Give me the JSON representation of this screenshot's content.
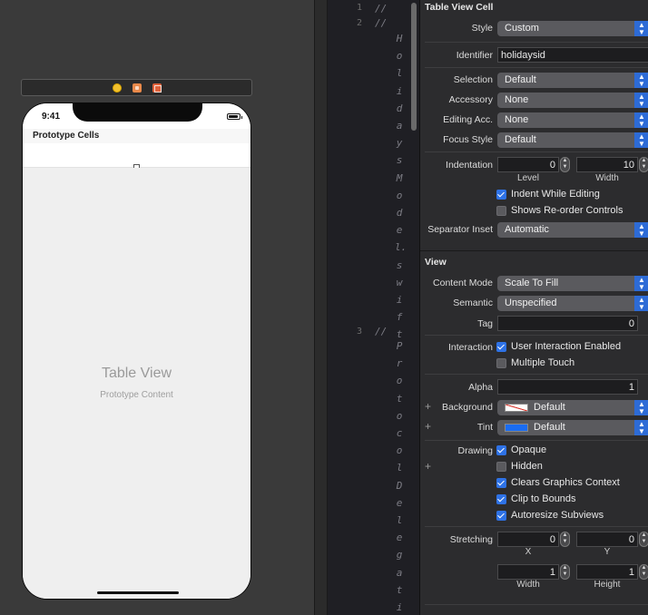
{
  "storyboard": {
    "status_time": "9:41",
    "prototype_header": "Prototype Cells",
    "table_title": "Table View",
    "table_subtitle": "Prototype Content",
    "dock_icons": [
      "view-controller-icon",
      "first-responder-icon",
      "exit-icon"
    ]
  },
  "editor": {
    "lines": [
      {
        "num": "1",
        "text": "//"
      },
      {
        "num": "2",
        "text": "//",
        "vertical": "HolidaysModel.swift"
      },
      {
        "num": "3",
        "text": "//",
        "vertical": "Protocol Delegatio"
      }
    ]
  },
  "inspector": {
    "table_view_cell": {
      "title": "Table View Cell",
      "style_label": "Style",
      "style_value": "Custom",
      "identifier_label": "Identifier",
      "identifier_value": "holidaysid",
      "selection_label": "Selection",
      "selection_value": "Default",
      "accessory_label": "Accessory",
      "accessory_value": "None",
      "editing_acc_label": "Editing Acc.",
      "editing_acc_value": "None",
      "focus_style_label": "Focus Style",
      "focus_style_value": "Default",
      "indentation_label": "Indentation",
      "indentation_level": "0",
      "level_label": "Level",
      "indentation_width": "10",
      "width_label": "Width",
      "indent_while_editing": "Indent While Editing",
      "shows_reorder": "Shows Re-order Controls",
      "separator_inset_label": "Separator Inset",
      "separator_inset_value": "Automatic"
    },
    "view": {
      "title": "View",
      "content_mode_label": "Content Mode",
      "content_mode_value": "Scale To Fill",
      "semantic_label": "Semantic",
      "semantic_value": "Unspecified",
      "tag_label": "Tag",
      "tag_value": "0",
      "interaction_label": "Interaction",
      "user_interaction": "User Interaction Enabled",
      "multiple_touch": "Multiple Touch",
      "alpha_label": "Alpha",
      "alpha_value": "1",
      "background_label": "Background",
      "background_value": "Default",
      "tint_label": "Tint",
      "tint_value": "Default",
      "tint_color": "#1a6cf2",
      "drawing_label": "Drawing",
      "opaque": "Opaque",
      "hidden": "Hidden",
      "clears_graphics": "Clears Graphics Context",
      "clip_to_bounds": "Clip to Bounds",
      "autoresize": "Autoresize Subviews",
      "stretching_label": "Stretching",
      "stretch_x": "0",
      "x_label": "X",
      "stretch_y": "0",
      "y_label": "Y",
      "stretch_w": "1",
      "width_label": "Width",
      "stretch_h": "1",
      "height_label": "Height"
    }
  }
}
